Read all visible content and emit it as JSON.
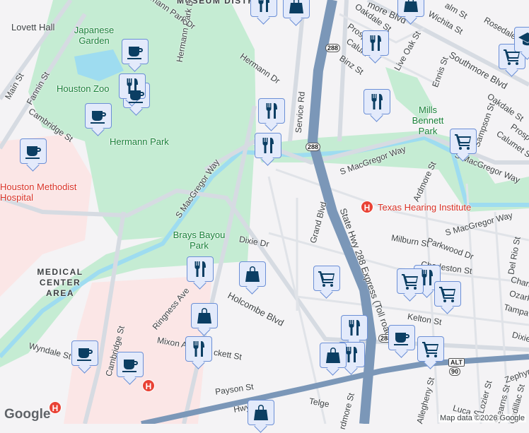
{
  "areas": {
    "museum_district": "MUSEUM DISTRICT",
    "medical_center": "MEDICAL CENTER AREA"
  },
  "parks": {
    "japanese_garden": "Japanese Garden",
    "houston_zoo": "Houston Zoo",
    "hermann_park": "Hermann Park",
    "brays_bayou_park": "Brays Bayou Park",
    "mills_bennett_park": "Mills Bennett Park"
  },
  "pois": {
    "lovett_hall": "Lovett Hall",
    "methodist": "Houston Methodist Hospital",
    "texas_hearing": "Texas Hearing Institute"
  },
  "streets": {
    "main": "Main St",
    "fannin": "Fannin St",
    "cambridge_n": "Cambridge St",
    "cambridge_s": "Cambridge St",
    "hermann_park_dr1": "Hermann Park Dr",
    "hermann_park_dr2": "Hermann Park Dr",
    "hermann_dr": "Hermann Dr",
    "s_macgregor_w": "S MacGregor Way",
    "s_macgregor_c": "S MacGregor Way",
    "s_macgregor_e": "S MacGregor Way",
    "s_macgregor_se": "S MacGregor Way",
    "service_rd": "Service Rd",
    "state_hwy": "State Hwy 288 Express (Toll road)",
    "grand_blvd": "Grand Blvd",
    "dixie": "Dixie Dr",
    "holcombe": "Holcombe Blvd",
    "ringness": "Ringness Ave",
    "mixon": "Mixon A",
    "brockett": "ckett St",
    "wyndale": "Wyndale St",
    "payson": "Payson St",
    "hwy_alt": "Hwy 90 Alt",
    "telge": "Telge",
    "ardmore_s": "rdmore St",
    "ardmore_n": "Ardmore St",
    "southmore": "Southmore Blvd",
    "southmore_top": "more Blvd",
    "oakdale": "Oakdale St",
    "oakdale_e": "Oakdale St",
    "prospect": "Prosp",
    "prospect_e": "Prospe",
    "calumet": "Calum",
    "calumet_e": "Calumet St",
    "binz": "Binz St",
    "live_oak": "Live Oak St",
    "wichita": "Wichita St",
    "palm": "alm St",
    "rosedale": "Rosedale",
    "ennis": "Ennis St",
    "sampson": "Sampson St",
    "milburn": "Milburn St",
    "parkwood": "Parkwood Dr",
    "charleston": "Charleston St",
    "charleston_e": "Charl",
    "del_rio": "Del Rio St",
    "ozark": "Ozark",
    "tampa": "Tampa",
    "kelton": "Kelton St",
    "dixie_e": "Dixie",
    "allegheny": "Allegheny St",
    "lozier": "Lozier St",
    "stearns": "Stearns St",
    "cadillac": "Cadillac St",
    "zephyr": "Zephyr",
    "luca": "Luca S",
    "hwy288": "288",
    "alt": "ALT",
    "us90": "90"
  },
  "markers": [
    "coffee",
    "coffee",
    "coffee",
    "coffee",
    "coffee",
    "coffee",
    "coffee",
    "restaurant",
    "restaurant",
    "restaurant",
    "restaurant",
    "restaurant",
    "restaurant",
    "restaurant",
    "restaurant",
    "restaurant",
    "restaurant",
    "restaurant",
    "shopping",
    "shopping",
    "shopping",
    "shopping",
    "shopping",
    "shopping",
    "grocery",
    "grocery",
    "grocery",
    "grocery",
    "grocery",
    "grocery",
    "school"
  ],
  "hospital_glyph": "H",
  "footer": {
    "logo": "Google",
    "attribution": "Map data ©2026 Google"
  },
  "colors": {
    "park": "#c2ecd1",
    "water": "#9edcf0",
    "highway": "#7b97b8",
    "medical": "#fbe4e4",
    "marker_fill": "#e3eafb",
    "marker_icon": "#0b3e63"
  }
}
